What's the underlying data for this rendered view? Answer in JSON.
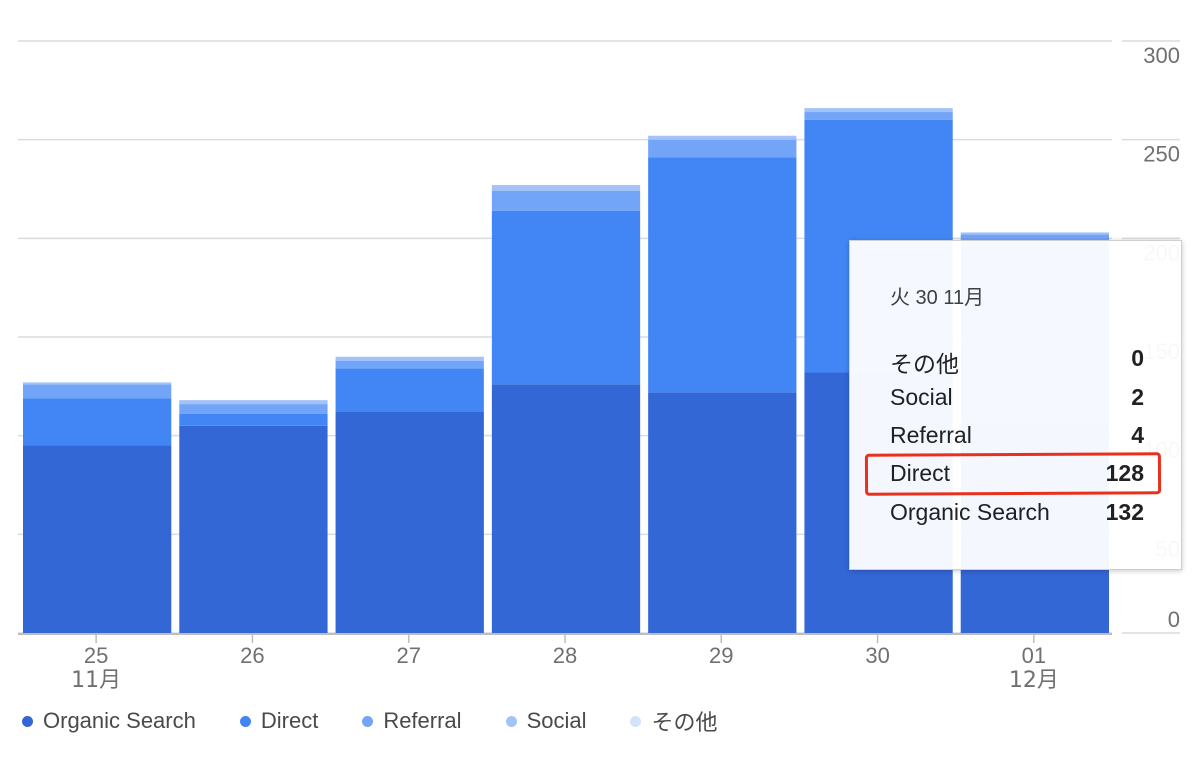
{
  "chart_data": {
    "type": "bar",
    "stacked": true,
    "categories": [
      "25",
      "26",
      "27",
      "28",
      "29",
      "30",
      "01"
    ],
    "month_labels": [
      "11月",
      "",
      "",
      "",
      "",
      "",
      "12月"
    ],
    "series": [
      {
        "name": "Organic Search",
        "color": "#3367d6",
        "values": [
          95,
          105,
          112,
          126,
          122,
          132,
          106
        ]
      },
      {
        "name": "Direct",
        "color": "#4285f4",
        "values": [
          24,
          6,
          22,
          88,
          119,
          128,
          92
        ]
      },
      {
        "name": "Referral",
        "color": "#72a4f7",
        "values": [
          7,
          5,
          4,
          10,
          9,
          4,
          4
        ]
      },
      {
        "name": "Social",
        "color": "#a2c2f9",
        "values": [
          1,
          2,
          2,
          3,
          2,
          2,
          1
        ]
      },
      {
        "name": "その他",
        "color": "#d2e3fc",
        "values": [
          0,
          0,
          0,
          0,
          0,
          0,
          0
        ]
      }
    ],
    "ylim": [
      0,
      300
    ],
    "yticks": [
      0,
      50,
      100,
      150,
      200,
      250,
      300
    ],
    "grid": true,
    "y_axis_side": "right",
    "legend": "bottom"
  },
  "tooltip": {
    "date": "火 30 11月",
    "rows": [
      {
        "label": "その他",
        "value": "0"
      },
      {
        "label": "Social",
        "value": "2"
      },
      {
        "label": "Referral",
        "value": "4"
      },
      {
        "label": "Direct",
        "value": "128"
      },
      {
        "label": "Organic Search",
        "value": "132"
      }
    ],
    "highlighted_row": "Direct"
  }
}
